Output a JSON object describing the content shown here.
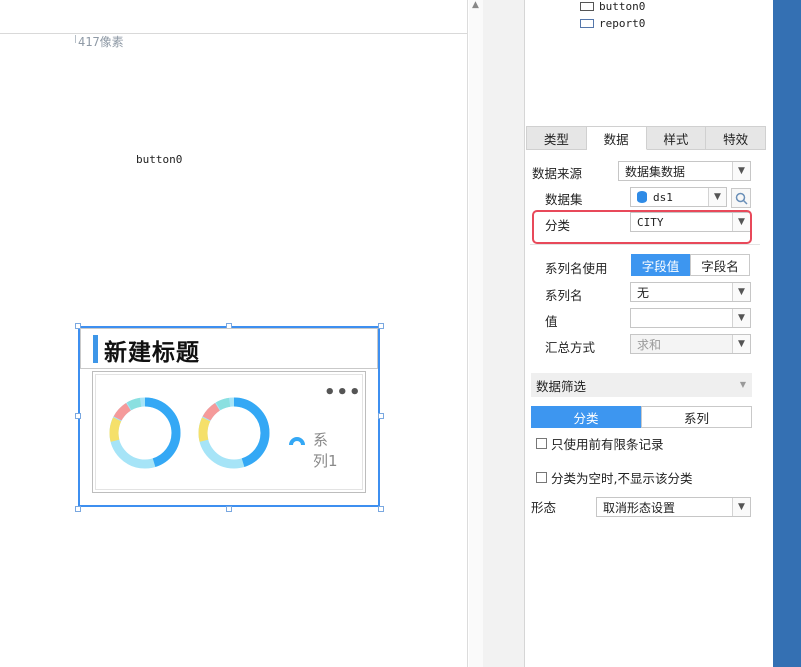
{
  "canvas": {
    "ruler_label": "417像素",
    "button_label": "button0",
    "widget": {
      "title": "新建标题",
      "more_icon": "more-horizontal-icon",
      "legend": "系列1",
      "donuts": [
        {
          "segments_colors": [
            "#34a8f5",
            "#a6e4f7",
            "#f5e06a",
            "#f59a9a",
            "#8ae0e0"
          ]
        },
        {
          "segments_colors": [
            "#34a8f5",
            "#a6e4f7",
            "#f5e06a",
            "#f59a9a",
            "#8ae0e0"
          ]
        }
      ]
    }
  },
  "tree": {
    "items": [
      {
        "label": "button0",
        "icon": "button-icon"
      },
      {
        "label": "report0",
        "icon": "report-icon"
      }
    ]
  },
  "tabs": [
    {
      "label": "类型",
      "active": false
    },
    {
      "label": "数据",
      "active": true
    },
    {
      "label": "样式",
      "active": false
    },
    {
      "label": "特效",
      "active": false
    }
  ],
  "data_source": {
    "label": "数据来源",
    "value": "数据集数据"
  },
  "dataset": {
    "label": "数据集",
    "value": "ds1",
    "icon": "database-icon"
  },
  "category": {
    "label": "分类",
    "value": "CITY"
  },
  "series_name_use": {
    "label": "系列名使用",
    "options": [
      "字段值",
      "字段名"
    ],
    "selected": 0
  },
  "series_name": {
    "label": "系列名",
    "value": "无"
  },
  "value_field": {
    "label": "值",
    "value": ""
  },
  "summary": {
    "label": "汇总方式",
    "value": "求和"
  },
  "filter": {
    "title": "数据筛选",
    "tabs": [
      "分类",
      "系列"
    ],
    "selected": 0,
    "checkbox1": "只使用前有限条记录",
    "checkbox2": "分类为空时,不显示该分类"
  },
  "shape": {
    "label": "形态",
    "value": "取消形态设置"
  },
  "colors": {
    "accent": "#3d96f0",
    "highlight": "#e8495a",
    "right_bar": "#3470b3"
  }
}
